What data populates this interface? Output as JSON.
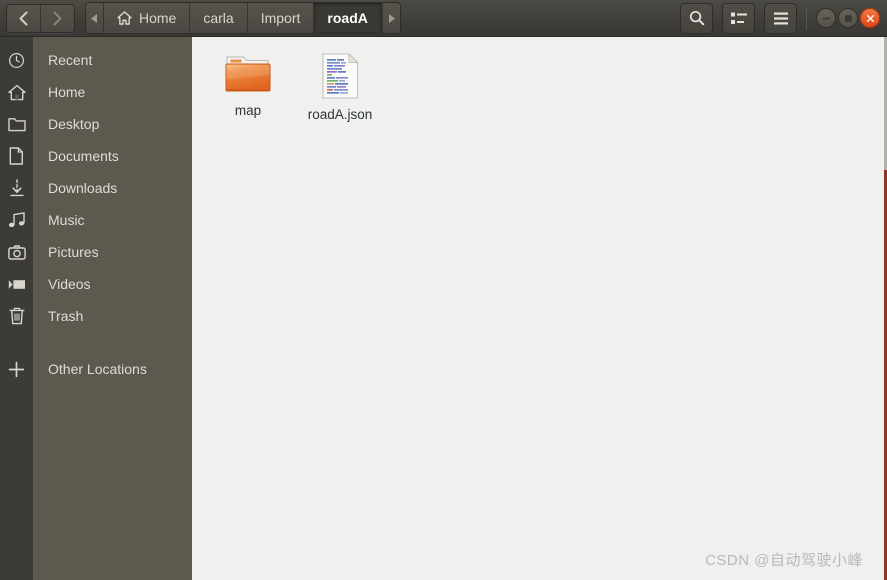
{
  "window": {
    "title": "roadA"
  },
  "header": {
    "nav": {
      "back_label": "Back",
      "forward_label": "Forward"
    },
    "breadcrumb": {
      "overflow_left_label": "Previous locations",
      "overflow_right_label": "Next locations",
      "items": [
        {
          "label": "Home",
          "icon": "home-icon",
          "active": false
        },
        {
          "label": "carla",
          "icon": "",
          "active": false
        },
        {
          "label": "Import",
          "icon": "",
          "active": false
        },
        {
          "label": "roadA",
          "icon": "",
          "active": true
        }
      ]
    },
    "actions": [
      {
        "name": "search-button",
        "icon": "search-icon",
        "label": "Search"
      },
      {
        "name": "view-options-button",
        "icon": "list-view-icon",
        "label": "View options"
      },
      {
        "name": "menu-button",
        "icon": "hamburger-menu-icon",
        "label": "Menu"
      }
    ],
    "window_controls": [
      {
        "name": "minimize-button",
        "icon": "minimize-icon",
        "label": "Minimize"
      },
      {
        "name": "maximize-button",
        "icon": "maximize-icon",
        "label": "Maximize"
      },
      {
        "name": "close-button",
        "icon": "close-icon",
        "label": "Close"
      }
    ]
  },
  "sidebar": {
    "items": [
      {
        "label": "Recent",
        "icon": "clock-icon"
      },
      {
        "label": "Home",
        "icon": "home-icon"
      },
      {
        "label": "Desktop",
        "icon": "folder-icon"
      },
      {
        "label": "Documents",
        "icon": "document-icon"
      },
      {
        "label": "Downloads",
        "icon": "download-arrow-icon"
      },
      {
        "label": "Music",
        "icon": "music-note-icon"
      },
      {
        "label": "Pictures",
        "icon": "camera-icon"
      },
      {
        "label": "Videos",
        "icon": "video-camera-icon"
      },
      {
        "label": "Trash",
        "icon": "trash-icon"
      },
      {
        "label": "Other Locations",
        "icon": "plus-icon"
      }
    ]
  },
  "main": {
    "files": [
      {
        "label": "map",
        "type": "folder",
        "icon": "folder-icon"
      },
      {
        "label": "roadA.json",
        "type": "file",
        "icon": "json-file-icon"
      }
    ]
  },
  "watermark": {
    "text": "CSDN @自动驾驶小峰"
  },
  "colors": {
    "header_bg": "#403e39",
    "sidebar_bg": "#5c5a4f",
    "rail_bg": "#3c3b36",
    "content_bg": "#f0f0ef",
    "accent_close": "#dd4814",
    "folder_orange": "#e8702a",
    "text_light": "#dedcd4",
    "text_dark": "#2e3436"
  }
}
